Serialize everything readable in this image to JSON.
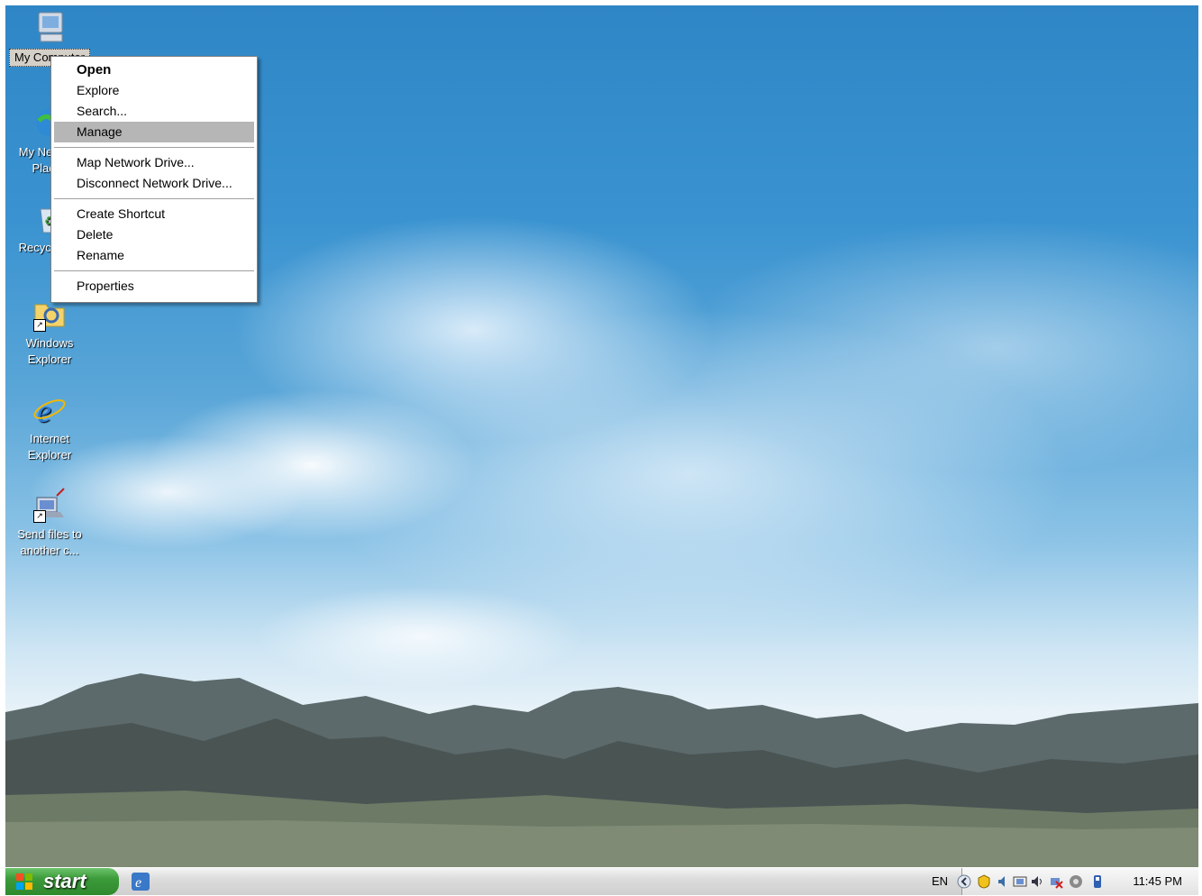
{
  "desktop": {
    "icons": [
      {
        "label": "My Computer",
        "name": "my-computer"
      },
      {
        "label": "My Network Places",
        "name": "my-network-places"
      },
      {
        "label": "Recycle Bin",
        "name": "recycle-bin"
      },
      {
        "label": "Windows Explorer",
        "name": "windows-explorer"
      },
      {
        "label": "Internet Explorer",
        "name": "internet-explorer"
      },
      {
        "label": "Send files to another c...",
        "name": "send-files"
      }
    ]
  },
  "context_menu": {
    "items": [
      {
        "label": "Open",
        "bold": true
      },
      {
        "label": "Explore"
      },
      {
        "label": "Search..."
      },
      {
        "label": "Manage",
        "highlighted": true
      },
      {
        "label": "Map Network Drive..."
      },
      {
        "label": "Disconnect Network Drive..."
      },
      {
        "label": "Create Shortcut"
      },
      {
        "label": "Delete"
      },
      {
        "label": "Rename"
      },
      {
        "label": "Properties"
      }
    ]
  },
  "taskbar": {
    "start_label": "start",
    "language": "EN",
    "clock": "11:45 PM",
    "tray_icons": [
      "show-hidden-icons-icon",
      "security-alert-icon",
      "speaker-icon",
      "network-icon",
      "volume-icon",
      "disconnected-network-icon",
      "antivirus-icon",
      "usb-remove-icon"
    ]
  },
  "colors": {
    "menu_highlight": "#b6b6b6",
    "start_green": "#3c9a3a"
  }
}
